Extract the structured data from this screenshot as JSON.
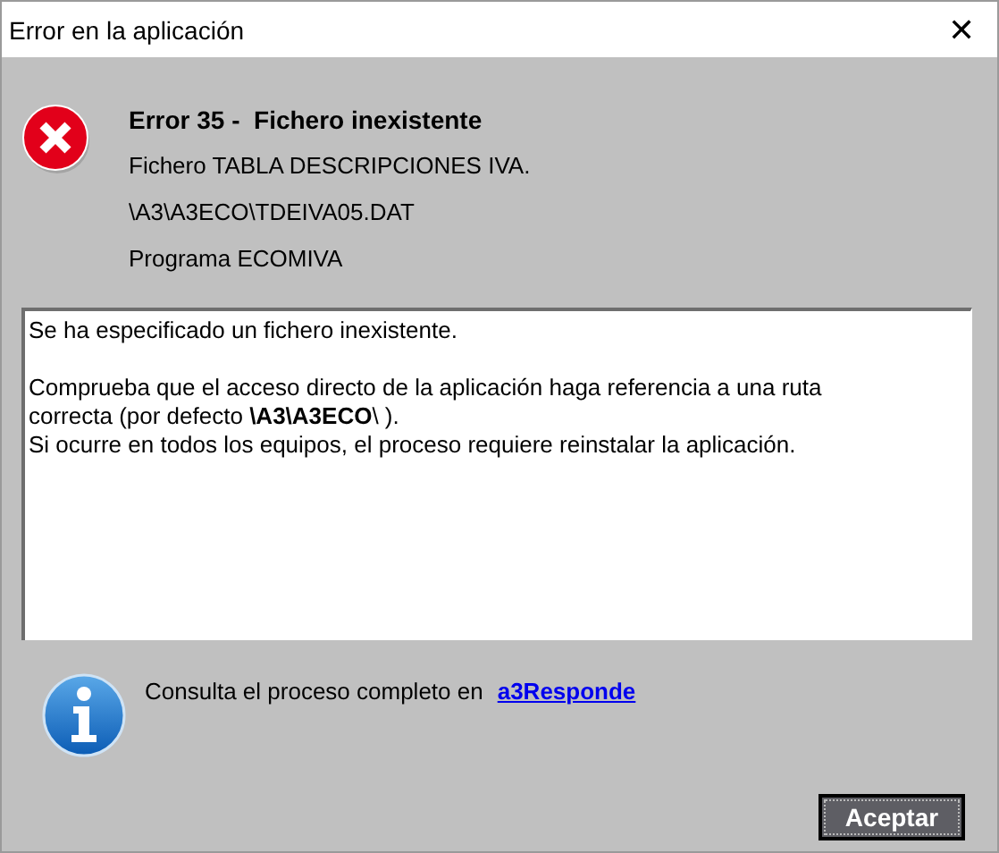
{
  "window": {
    "title": "Error en la aplicación",
    "close": "✕"
  },
  "error": {
    "title": "Error 35 -  Fichero inexistente",
    "details": [
      "Fichero TABLA DESCRIPCIONES IVA.",
      "\\A3\\A3ECO\\TDEIVA05.DAT",
      "Programa ECOMIVA"
    ]
  },
  "message": {
    "paragraphs": [
      [
        "Se ha especificado un fichero inexistente."
      ],
      [
        "Comprueba que el acceso directo de la aplicación haga referencia a una ruta correcta (por defecto **\\A3\\A3ECO**\\ ).",
        "Si ocurre en todos los equipos, el proceso requiere reinstalar la aplicación."
      ]
    ]
  },
  "info": {
    "text": "Consulta el proceso completo en",
    "link": "a3Responde"
  },
  "buttons": [
    "Aceptar"
  ]
}
